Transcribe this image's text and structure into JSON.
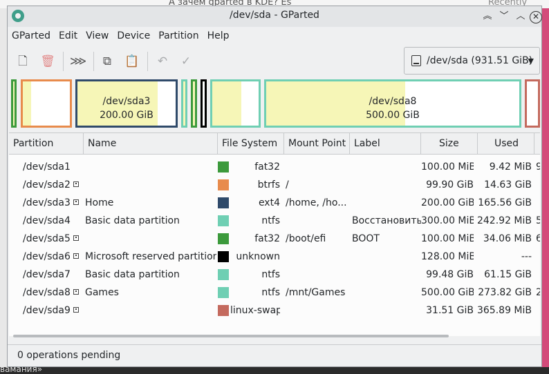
{
  "window": {
    "title": "/dev/sda - GParted"
  },
  "background": {
    "top_text": "А зачем gparted в KDE? Es",
    "top_right_text": "Recently used",
    "bottom_text": "вамания»"
  },
  "menu": [
    "GParted",
    "Edit",
    "View",
    "Device",
    "Partition",
    "Help"
  ],
  "device": {
    "label": "/dev/sda (931.51 GiB)"
  },
  "map": {
    "sda3": {
      "name": "/dev/sda3",
      "size": "200.00 GiB"
    },
    "sda8": {
      "name": "/dev/sda8",
      "size": "500.00 GiB"
    }
  },
  "columns": [
    "Partition",
    "Name",
    "File System",
    "Mount Point",
    "Label",
    "Size",
    "Used"
  ],
  "rows": [
    {
      "partition": "/dev/sda1",
      "name": "",
      "fs": "fat32",
      "fs_color": "#3c9a3c",
      "mount": "",
      "label": "",
      "size": "100.00 MiB",
      "used": "9.42 MiB",
      "extra": "9",
      "lock": false
    },
    {
      "partition": "/dev/sda2",
      "name": "",
      "fs": "btrfs",
      "fs_color": "#e88b4c",
      "mount": "/",
      "label": "",
      "size": "99.90 GiB",
      "used": "14.63 GiB",
      "extra": "",
      "lock": true
    },
    {
      "partition": "/dev/sda3",
      "name": "Home",
      "fs": "ext4",
      "fs_color": "#2f4a6a",
      "mount": "/home, /ho...",
      "label": "",
      "size": "200.00 GiB",
      "used": "165.56 GiB",
      "extra": "",
      "lock": true
    },
    {
      "partition": "/dev/sda4",
      "name": "Basic data partition",
      "fs": "ntfs",
      "fs_color": "#6fcfb3",
      "mount": "",
      "label": "Восстановить",
      "size": "300.00 MiB",
      "used": "242.92 MiB",
      "extra": "5",
      "lock": false
    },
    {
      "partition": "/dev/sda5",
      "name": "",
      "fs": "fat32",
      "fs_color": "#3c9a3c",
      "mount": "/boot/efi",
      "label": "BOOT",
      "size": "100.00 MiB",
      "used": "34.06 MiB",
      "extra": "6.",
      "lock": true
    },
    {
      "partition": "/dev/sda6",
      "name": "Microsoft reserved partition",
      "fs": "unknown",
      "fs_color": "#000000",
      "mount": "",
      "label": "",
      "size": "128.00 MiB",
      "used": "---",
      "extra": "",
      "lock": true
    },
    {
      "partition": "/dev/sda7",
      "name": "Basic data partition",
      "fs": "ntfs",
      "fs_color": "#6fcfb3",
      "mount": "",
      "label": "",
      "size": "99.48 GiB",
      "used": "61.15 GiB",
      "extra": "",
      "lock": false
    },
    {
      "partition": "/dev/sda8",
      "name": "Games",
      "fs": "ntfs",
      "fs_color": "#6fcfb3",
      "mount": "/mnt/Games",
      "label": "",
      "size": "500.00 GiB",
      "used": "273.82 GiB",
      "extra": "2",
      "lock": true
    },
    {
      "partition": "/dev/sda9",
      "name": "",
      "fs": "linux-swap",
      "fs_color": "#c46a5e",
      "mount": "",
      "label": "",
      "size": "31.51 GiB",
      "used": "365.89 MiB",
      "extra": "",
      "lock": true
    }
  ],
  "status": {
    "text": "0 operations pending"
  }
}
